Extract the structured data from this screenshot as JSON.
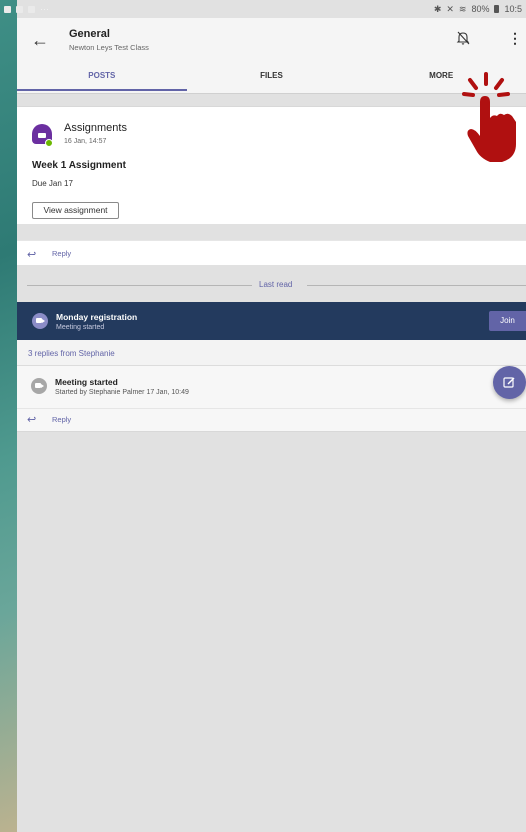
{
  "status_bar": {
    "left_icons": [
      "notification-icon",
      "download-icon",
      "image-icon"
    ],
    "left_more": "···",
    "right_text": "80%",
    "time": "10:5"
  },
  "header": {
    "title": "General",
    "subtitle": "Newton Leys Test Class"
  },
  "tabs": [
    {
      "label": "POSTS",
      "active": true
    },
    {
      "label": "FILES",
      "active": false
    },
    {
      "label": "MORE",
      "active": false
    }
  ],
  "assignment_post": {
    "sender": "Assignments",
    "timestamp": "16 Jan, 14:57",
    "assignment_title": "Week 1 Assignment",
    "due": "Due Jan 17",
    "view_button": "View assignment",
    "reply_label": "Reply"
  },
  "last_read_label": "Last read",
  "meeting_banner": {
    "title": "Monday registration",
    "subtitle": "Meeting started",
    "join_label": "Join"
  },
  "replies_summary": "3 replies from Stephanie",
  "meeting_post": {
    "title": "Meeting started",
    "subtitle": "Started by Stephanie Palmer   17 Jan, 10:49",
    "reply_label": "Reply"
  },
  "colors": {
    "accent": "#6264a7",
    "banner": "#233a5e",
    "hand": "#b01010"
  }
}
